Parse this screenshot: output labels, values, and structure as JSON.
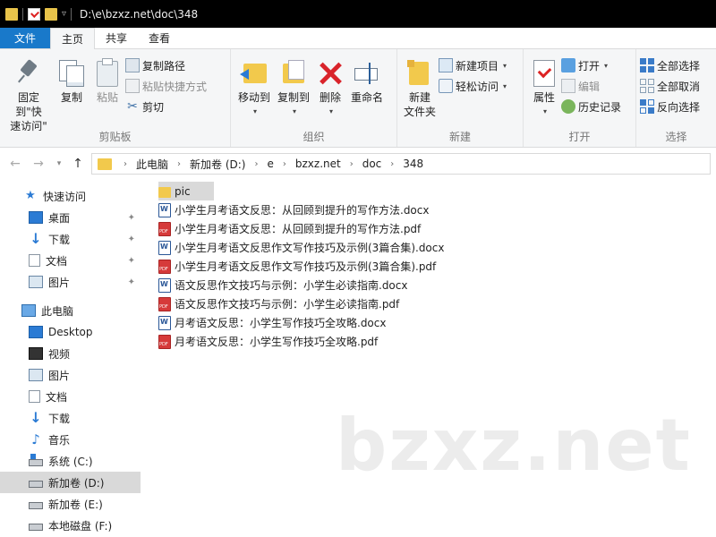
{
  "titlebar": {
    "path": "D:\\e\\bzxz.net\\doc\\348"
  },
  "tabs": [
    {
      "label": "文件"
    },
    {
      "label": "主页"
    },
    {
      "label": "共享"
    },
    {
      "label": "查看"
    }
  ],
  "ribbon": {
    "clipboard": {
      "pin_label_1": "固定到\"快",
      "pin_label_2": "速访问\"",
      "copy_label": "复制",
      "paste_label": "粘贴",
      "copy_path_label": "复制路径",
      "paste_shortcut_label": "粘贴快捷方式",
      "cut_label": "剪切",
      "group_label": "剪贴板"
    },
    "organize": {
      "move_to_label": "移动到",
      "copy_to_label": "复制到",
      "delete_label": "删除",
      "rename_label": "重命名",
      "group_label": "组织"
    },
    "new": {
      "new_folder_label_1": "新建",
      "new_folder_label_2": "文件夹",
      "new_item_label": "新建项目",
      "easy_access_label": "轻松访问",
      "group_label": "新建"
    },
    "open": {
      "properties_label": "属性",
      "open_label": "打开",
      "edit_label": "编辑",
      "history_label": "历史记录",
      "group_label": "打开"
    },
    "select": {
      "select_all_label": "全部选择",
      "select_none_label": "全部取消",
      "invert_label": "反向选择",
      "group_label": "选择"
    }
  },
  "address": {
    "crumbs": [
      "此电脑",
      "新加卷 (D:)",
      "e",
      "bzxz.net",
      "doc",
      "348"
    ]
  },
  "sidebar": {
    "quick_access": "快速访问",
    "quick_items": [
      {
        "label": "桌面"
      },
      {
        "label": "下载"
      },
      {
        "label": "文档"
      },
      {
        "label": "图片"
      }
    ],
    "this_pc": "此电脑",
    "pc_items": [
      {
        "label": "Desktop"
      },
      {
        "label": "视频"
      },
      {
        "label": "图片"
      },
      {
        "label": "文档"
      },
      {
        "label": "下载"
      },
      {
        "label": "音乐"
      },
      {
        "label": "系统 (C:)"
      },
      {
        "label": "新加卷 (D:)"
      },
      {
        "label": "新加卷 (E:)"
      },
      {
        "label": "本地磁盘 (F:)"
      }
    ]
  },
  "files": [
    {
      "name": "pic",
      "type": "folder"
    },
    {
      "name": "小学生月考语文反思：从回顾到提升的写作方法.docx",
      "type": "docx"
    },
    {
      "name": "小学生月考语文反思：从回顾到提升的写作方法.pdf",
      "type": "pdf"
    },
    {
      "name": "小学生月考语文反思作文写作技巧及示例(3篇合集).docx",
      "type": "docx"
    },
    {
      "name": "小学生月考语文反思作文写作技巧及示例(3篇合集).pdf",
      "type": "pdf"
    },
    {
      "name": "语文反思作文技巧与示例：小学生必读指南.docx",
      "type": "docx"
    },
    {
      "name": "语文反思作文技巧与示例：小学生必读指南.pdf",
      "type": "pdf"
    },
    {
      "name": "月考语文反思：小学生写作技巧全攻略.docx",
      "type": "docx"
    },
    {
      "name": "月考语文反思：小学生写作技巧全攻略.pdf",
      "type": "pdf"
    }
  ],
  "watermark": "bzxz.net"
}
